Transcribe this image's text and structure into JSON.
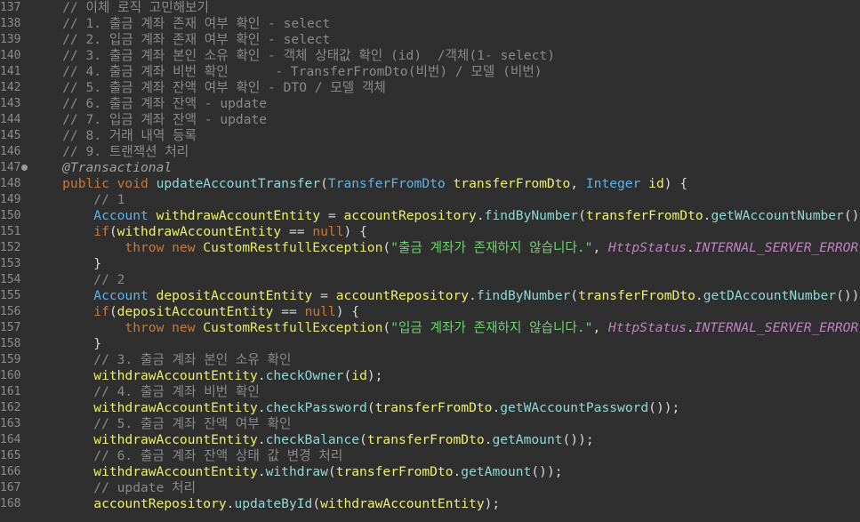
{
  "editor": {
    "lines": [
      {
        "n": "137",
        "segs": [
          [
            "cm",
            "    // 이체 로직 고민해보기"
          ]
        ]
      },
      {
        "n": "138",
        "segs": [
          [
            "cm",
            "    // 1. 출금 계좌 존재 여부 확인 - select"
          ]
        ]
      },
      {
        "n": "139",
        "segs": [
          [
            "cm",
            "    // 2. 입금 계좌 존재 여부 확인 - select"
          ]
        ]
      },
      {
        "n": "140",
        "segs": [
          [
            "cm",
            "    // 3. 출금 계좌 본인 소유 확인 - 객체 상태값 확인 (id)  /객체(1- select)"
          ]
        ]
      },
      {
        "n": "141",
        "segs": [
          [
            "cm",
            "    // 4. 출금 계좌 비번 확인      - TransferFromDto(비번) / 모델 (비번)"
          ]
        ]
      },
      {
        "n": "142",
        "segs": [
          [
            "cm",
            "    // 5. 출금 계좌 잔액 여부 확인 - DTO / 모델 객체"
          ]
        ]
      },
      {
        "n": "143",
        "segs": [
          [
            "cm",
            "    // 6. 출금 계좌 잔액 - update"
          ]
        ]
      },
      {
        "n": "144",
        "segs": [
          [
            "cm",
            "    // 7. 입금 계좌 잔액 - update"
          ]
        ]
      },
      {
        "n": "145",
        "segs": [
          [
            "cm",
            "    // 8. 거래 내역 등록"
          ]
        ]
      },
      {
        "n": "146",
        "segs": [
          [
            "cm",
            "    // 9. 트랜잭션 처리"
          ]
        ]
      },
      {
        "n": "147",
        "marker": true,
        "segs": [
          [
            "an",
            "    @Transactional"
          ]
        ]
      },
      {
        "n": "148",
        "segs": [
          [
            "kw",
            "    public void "
          ],
          [
            "fn",
            "updateAccountTransfer"
          ],
          [
            "pu",
            "("
          ],
          [
            "ty",
            "TransferFromDto "
          ],
          [
            "va",
            "transferFromDto"
          ],
          [
            "pu",
            ", "
          ],
          [
            "ty",
            "Integer "
          ],
          [
            "va",
            "id"
          ],
          [
            "pu",
            ") {"
          ]
        ]
      },
      {
        "n": "149",
        "segs": [
          [
            "cm",
            "        // 1"
          ]
        ]
      },
      {
        "n": "150",
        "segs": [
          [
            "ty",
            "        Account "
          ],
          [
            "va",
            "withdrawAccountEntity"
          ],
          [
            "pu",
            " = "
          ],
          [
            "va",
            "accountRepository"
          ],
          [
            "pu",
            "."
          ],
          [
            "fn",
            "findByNumber"
          ],
          [
            "pu",
            "("
          ],
          [
            "va",
            "transferFromDto"
          ],
          [
            "pu",
            "."
          ],
          [
            "fn",
            "getWAccountNumber"
          ],
          [
            "pu",
            "());"
          ]
        ]
      },
      {
        "n": "151",
        "segs": [
          [
            "kw",
            "        if"
          ],
          [
            "pu",
            "("
          ],
          [
            "va",
            "withdrawAccountEntity"
          ],
          [
            "pu",
            " == "
          ],
          [
            "kw",
            "null"
          ],
          [
            "pu",
            ") {"
          ]
        ]
      },
      {
        "n": "152",
        "segs": [
          [
            "kw",
            "            throw new "
          ],
          [
            "ex",
            "CustomRestfullException"
          ],
          [
            "pu",
            "("
          ],
          [
            "st",
            "\"출금 계좌가 존재하지 않습니다.\""
          ],
          [
            "pu",
            ", "
          ],
          [
            "cs",
            "HttpStatus"
          ],
          [
            "pu",
            "."
          ],
          [
            "cs",
            "INTERNAL_SERVER_ERROR"
          ],
          [
            "pu",
            ");"
          ]
        ]
      },
      {
        "n": "153",
        "segs": [
          [
            "pu",
            "        }"
          ]
        ]
      },
      {
        "n": "154",
        "segs": [
          [
            "cm",
            "        // 2"
          ]
        ]
      },
      {
        "n": "155",
        "segs": [
          [
            "ty",
            "        Account "
          ],
          [
            "va",
            "depositAccountEntity"
          ],
          [
            "pu",
            " = "
          ],
          [
            "va",
            "accountRepository"
          ],
          [
            "pu",
            "."
          ],
          [
            "fn",
            "findByNumber"
          ],
          [
            "pu",
            "("
          ],
          [
            "va",
            "transferFromDto"
          ],
          [
            "pu",
            "."
          ],
          [
            "fn",
            "getDAccountNumber"
          ],
          [
            "pu",
            "());"
          ]
        ]
      },
      {
        "n": "156",
        "segs": [
          [
            "kw",
            "        if"
          ],
          [
            "pu",
            "("
          ],
          [
            "va",
            "depositAccountEntity"
          ],
          [
            "pu",
            " == "
          ],
          [
            "kw",
            "null"
          ],
          [
            "pu",
            ") {"
          ]
        ]
      },
      {
        "n": "157",
        "segs": [
          [
            "kw",
            "            throw new "
          ],
          [
            "ex",
            "CustomRestfullException"
          ],
          [
            "pu",
            "("
          ],
          [
            "st",
            "\"입금 계좌가 존재하지 않습니다.\""
          ],
          [
            "pu",
            ", "
          ],
          [
            "cs",
            "HttpStatus"
          ],
          [
            "pu",
            "."
          ],
          [
            "cs",
            "INTERNAL_SERVER_ERROR"
          ],
          [
            "pu",
            ");"
          ]
        ]
      },
      {
        "n": "158",
        "segs": [
          [
            "pu",
            "        }"
          ]
        ]
      },
      {
        "n": "159",
        "segs": [
          [
            "cm",
            "        // 3. 출금 계좌 본인 소유 확인"
          ]
        ]
      },
      {
        "n": "160",
        "segs": [
          [
            "va",
            "        withdrawAccountEntity"
          ],
          [
            "pu",
            "."
          ],
          [
            "fn",
            "checkOwner"
          ],
          [
            "pu",
            "("
          ],
          [
            "va",
            "id"
          ],
          [
            "pu",
            ");"
          ]
        ]
      },
      {
        "n": "161",
        "segs": [
          [
            "cm",
            "        // 4. 출금 계좌 비번 확인"
          ]
        ]
      },
      {
        "n": "162",
        "segs": [
          [
            "va",
            "        withdrawAccountEntity"
          ],
          [
            "pu",
            "."
          ],
          [
            "fn",
            "checkPassword"
          ],
          [
            "pu",
            "("
          ],
          [
            "va",
            "transferFromDto"
          ],
          [
            "pu",
            "."
          ],
          [
            "fn",
            "getWAccountPassword"
          ],
          [
            "pu",
            "());"
          ]
        ]
      },
      {
        "n": "163",
        "segs": [
          [
            "cm",
            "        // 5. 출금 계좌 잔액 여부 확인"
          ]
        ]
      },
      {
        "n": "164",
        "segs": [
          [
            "va",
            "        withdrawAccountEntity"
          ],
          [
            "pu",
            "."
          ],
          [
            "fn",
            "checkBalance"
          ],
          [
            "pu",
            "("
          ],
          [
            "va",
            "transferFromDto"
          ],
          [
            "pu",
            "."
          ],
          [
            "fn",
            "getAmount"
          ],
          [
            "pu",
            "());"
          ]
        ]
      },
      {
        "n": "165",
        "segs": [
          [
            "cm",
            "        // 6. 출금 계좌 잔액 상태 값 변경 처리"
          ]
        ]
      },
      {
        "n": "166",
        "segs": [
          [
            "va",
            "        withdrawAccountEntity"
          ],
          [
            "pu",
            "."
          ],
          [
            "fn",
            "withdraw"
          ],
          [
            "pu",
            "("
          ],
          [
            "va",
            "transferFromDto"
          ],
          [
            "pu",
            "."
          ],
          [
            "fn",
            "getAmount"
          ],
          [
            "pu",
            "());"
          ]
        ]
      },
      {
        "n": "167",
        "segs": [
          [
            "cm",
            "        // update 처리"
          ]
        ]
      },
      {
        "n": "168",
        "segs": [
          [
            "va",
            "        accountRepository"
          ],
          [
            "pu",
            "."
          ],
          [
            "fn",
            "updateById"
          ],
          [
            "pu",
            "("
          ],
          [
            "va",
            "withdrawAccountEntity"
          ],
          [
            "pu",
            ");"
          ]
        ]
      }
    ]
  }
}
